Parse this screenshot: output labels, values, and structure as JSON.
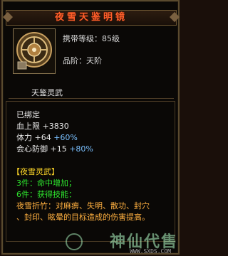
{
  "item": {
    "name": "夜雪天鉴明镜",
    "carry_level": "携带等级：85级",
    "grade": "品阶：天阶",
    "spirit_name": "天鉴灵武",
    "bound": "已绑定"
  },
  "stats": [
    {
      "label": "血上限",
      "base": "+3830",
      "bonus": ""
    },
    {
      "label": "体力",
      "base": "+64",
      "bonus": "+60%"
    },
    {
      "label": "会心防御",
      "base": "+15",
      "bonus": "+80%"
    }
  ],
  "set": {
    "title": "【夜雪灵武】",
    "bonus3": "3件：命中增加；",
    "bonus6": "6件：获得技能：",
    "skill_line1": "夜雪折竹：对麻痹、失明、散功、封穴",
    "skill_line2": "、封印、眩晕的目标造成的伤害提高。"
  },
  "watermark": {
    "text": "神仙代售",
    "url": "WWW.SXDS.COM"
  },
  "colors": {
    "title": "#ff5e2a",
    "stat_base": "#7ac0ff",
    "set_title": "#ffd728",
    "set_bonus": "#2ee62e",
    "skill": "#ffb040"
  }
}
